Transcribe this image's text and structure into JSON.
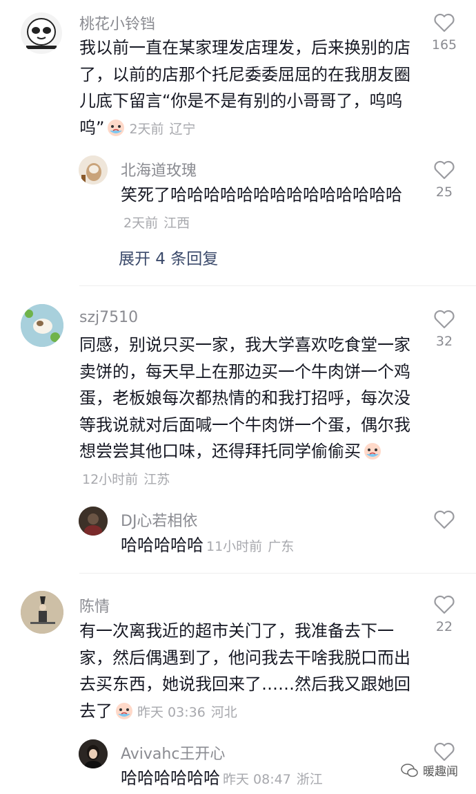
{
  "comments": [
    {
      "username": "桃花小铃铛",
      "text": "我以前一直在某家理发店理发，后来换别的店了，以前的店那个托尼委委屈屈的在我朋友圈儿底下留言“你是不是有别的小哥哥了，呜呜呜”",
      "emoji": "crying-emoji",
      "time": "2天前",
      "location": "辽宁",
      "likes": "165",
      "reply": {
        "username": "北海道玫瑰",
        "text": "笑死了哈哈哈哈哈哈哈哈哈哈哈哈哈哈",
        "time": "2天前",
        "location": "江西",
        "likes": "25"
      },
      "expand_label": "展开 4 条回复"
    },
    {
      "username": "szj7510",
      "text": "同感，别说只买一家，我大学喜欢吃食堂一家卖饼的，每天早上在那边买一个牛肉饼一个鸡蛋，老板娘每次都热情的和我打招呼，每次没等我说就对后面喊一个牛肉饼一个蛋，偶尔我想尝尝其他口味，还得拜托同学偷偷买",
      "emoji": "crying-emoji",
      "time": "12小时前",
      "location": "江苏",
      "likes": "32",
      "reply": {
        "username": "DJ心若相依",
        "text": "哈哈哈哈哈",
        "time": "11小时前",
        "location": "广东",
        "likes": ""
      }
    },
    {
      "username": "陈情",
      "text": "有一次离我近的超市关门了，我准备去下一家，然后偶遇到了，他问我去干啥我脱口而出去买东西，她说我回来了……然后我又跟她回去了",
      "emoji": "crying-emoji",
      "time": "昨天 03:36",
      "location": "河北",
      "likes": "22",
      "reply": {
        "username": "Avivahc王开心",
        "text": "哈哈哈哈哈哈",
        "time": "昨天 08:47",
        "location": "浙江",
        "likes": ""
      }
    }
  ],
  "watermark": "暖趣闻",
  "colors": {
    "text": "#161823",
    "username": "#8a8b91",
    "meta": "#a7a8ad",
    "expand": "#3b4a6b"
  }
}
